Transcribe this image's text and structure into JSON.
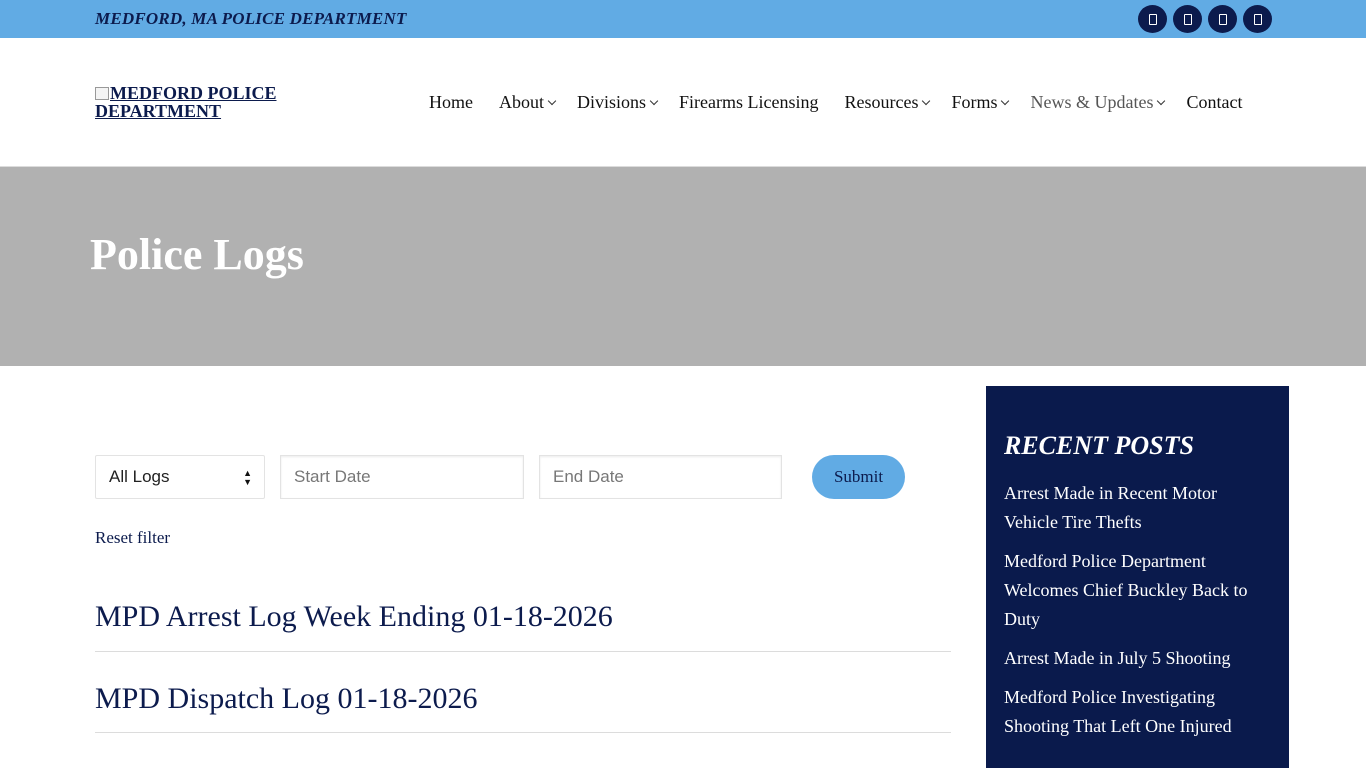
{
  "topbar": {
    "department": "MEDFORD, MA POLICE DEPARTMENT",
    "social_icons": [
      "facebook-icon",
      "twitter-icon",
      "instagram-icon",
      "youtube-icon"
    ]
  },
  "header": {
    "logo_alt": "MEDFORD POLICE DEPARTMENT",
    "nav": [
      {
        "label": "Home",
        "dropdown": false
      },
      {
        "label": "About",
        "dropdown": true
      },
      {
        "label": "Divisions",
        "dropdown": true
      },
      {
        "label": "Firearms Licensing",
        "dropdown": false
      },
      {
        "label": "Resources",
        "dropdown": true
      },
      {
        "label": "Forms",
        "dropdown": true
      },
      {
        "label": "News & Updates",
        "dropdown": true
      },
      {
        "label": "Contact",
        "dropdown": false
      }
    ]
  },
  "hero": {
    "title": "Police Logs"
  },
  "filters": {
    "log_type": "All Logs",
    "start_placeholder": "Start Date",
    "end_placeholder": "End Date",
    "submit_label": "Submit",
    "reset_label": "Reset filter"
  },
  "logs": [
    {
      "title": "MPD Arrest Log Week Ending 01-18-2026"
    },
    {
      "title": "MPD Dispatch Log 01-18-2026"
    }
  ],
  "sidebar": {
    "heading": "RECENT POSTS",
    "posts": [
      "Arrest Made in Recent Motor Vehicle Tire Thefts",
      "Medford Police Department Welcomes Chief Buckley Back to Duty",
      "Arrest Made in July 5 Shooting",
      "Medford Police Investigating Shooting That Left One Injured"
    ]
  },
  "colors": {
    "topbar": "#61abe4",
    "navy": "#0c1b4d",
    "hero": "#b1b1b1",
    "sidebar": "#0a1a4c"
  }
}
